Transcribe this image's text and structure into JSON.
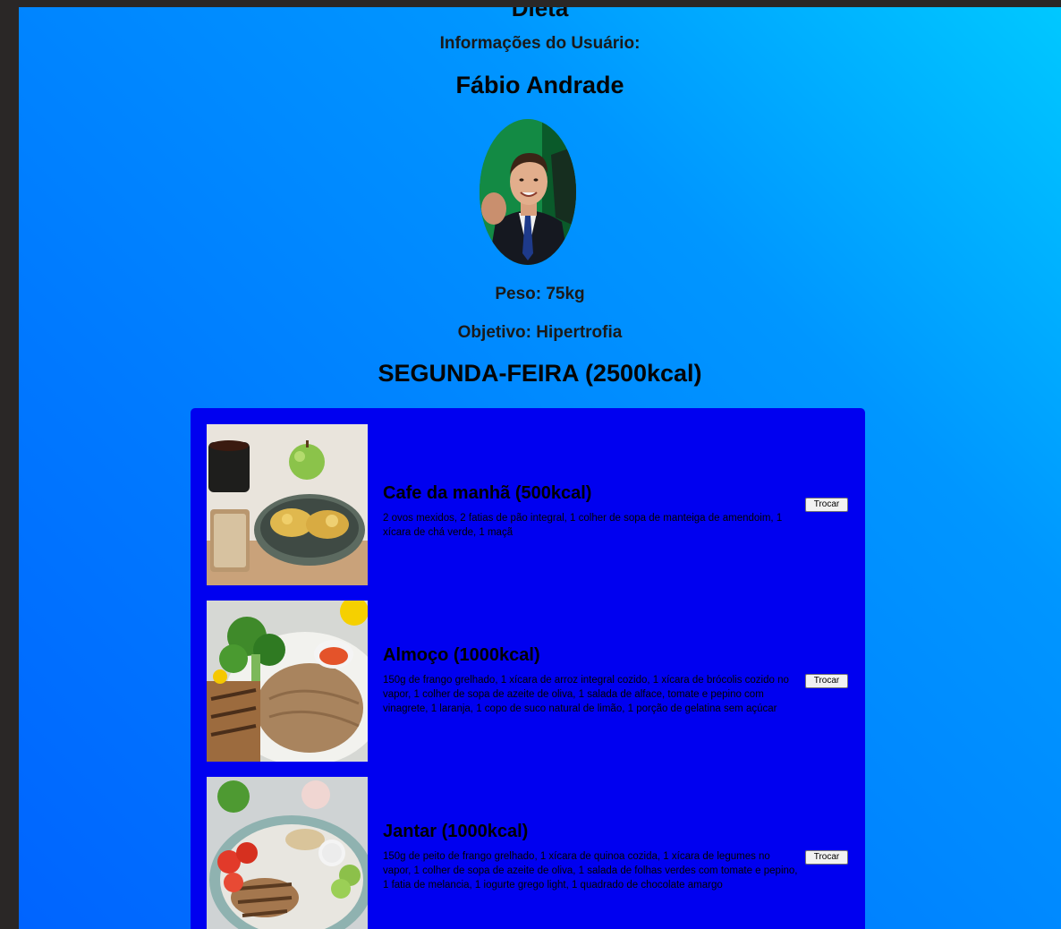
{
  "header": {
    "title": "Dieta",
    "info_label": "Informações do Usuário:",
    "user_name": "Fábio Andrade",
    "weight": "Peso: 75kg",
    "goal": "Objetivo: Hipertrofia"
  },
  "day": {
    "title": "SEGUNDA-FEIRA (2500kcal)"
  },
  "meals": [
    {
      "title": "Cafe da manhã (500kcal)",
      "description": "2 ovos mexidos, 2 fatias de pão integral, 1 colher de sopa de manteiga de amendoim, 1 xícara de chá verde, 1 maçã",
      "button": "Trocar"
    },
    {
      "title": "Almoço (1000kcal)",
      "description": "150g de frango grelhado, 1 xícara de arroz integral cozido, 1 xícara de brócolis cozido no vapor, 1 colher de sopa de azeite de oliva, 1 salada de alface, tomate e pepino com vinagrete, 1 laranja, 1 copo de suco natural de limão, 1 porção de gelatina sem açúcar",
      "button": "Trocar"
    },
    {
      "title": "Jantar (1000kcal)",
      "description": "150g de peito de frango grelhado, 1 xícara de quinoa cozida, 1 xícara de legumes no vapor, 1 colher de sopa de azeite de oliva, 1 salada de folhas verdes com tomate e pepino, 1 fatia de melancia, 1 iogurte grego light, 1 quadrado de chocolate amargo",
      "button": "Trocar"
    }
  ]
}
